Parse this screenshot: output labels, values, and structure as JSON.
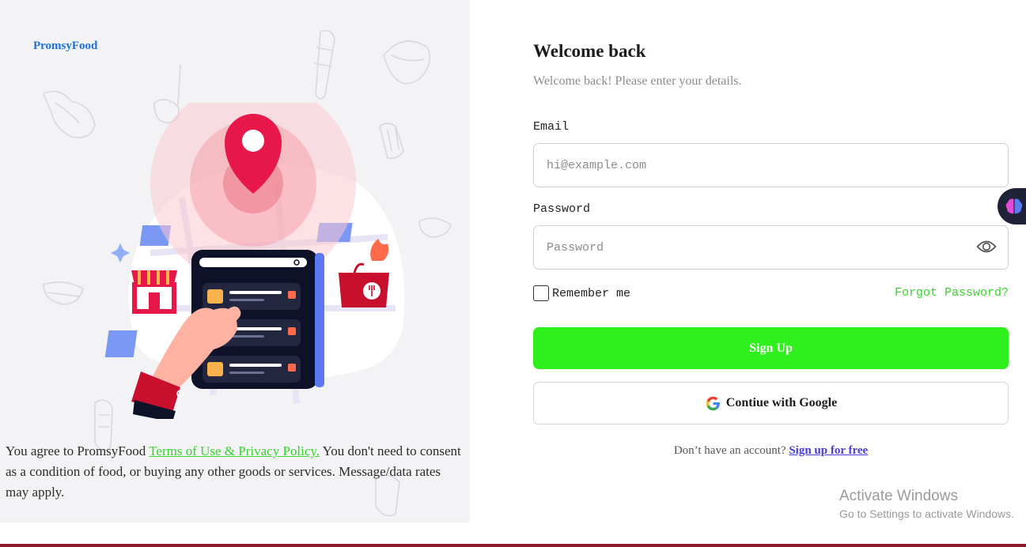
{
  "brand": {
    "name": "PromsyFood"
  },
  "terms": {
    "prefix": "You agree to PromsyFood ",
    "link": "Terms of Use & Privacy Policy.",
    "suffix": " You don't need to consent as a condition of food, or buying any other goods or services. Message/data rates may apply."
  },
  "login": {
    "title": "Welcome back",
    "subtitle": "Welcome back! Please enter your details.",
    "email_label": "Email",
    "email_placeholder": "hi@example.com",
    "password_label": "Password",
    "password_placeholder": "Password",
    "remember_label": "Remember me",
    "forgot_label": "Forgot Password?",
    "signup_button": "Sign Up",
    "google_button": "Contiue with Google",
    "no_account_text": "Don’t have an account?",
    "signup_link": "Sign up for free"
  },
  "icons": {
    "brand_hero": "map-pin-phone-illustration",
    "password_toggle": "eye-icon",
    "google": "google-icon",
    "extension": "brain-icon"
  },
  "colors": {
    "accent_green": "#2ff01c",
    "link_green": "#35d62c",
    "brand_blue": "#1f6fd6",
    "link_purple": "#4a3bd6",
    "pin_red": "#e8174a"
  },
  "os_watermark": {
    "title": "Activate Windows",
    "subtitle": "Go to Settings to activate Windows."
  }
}
